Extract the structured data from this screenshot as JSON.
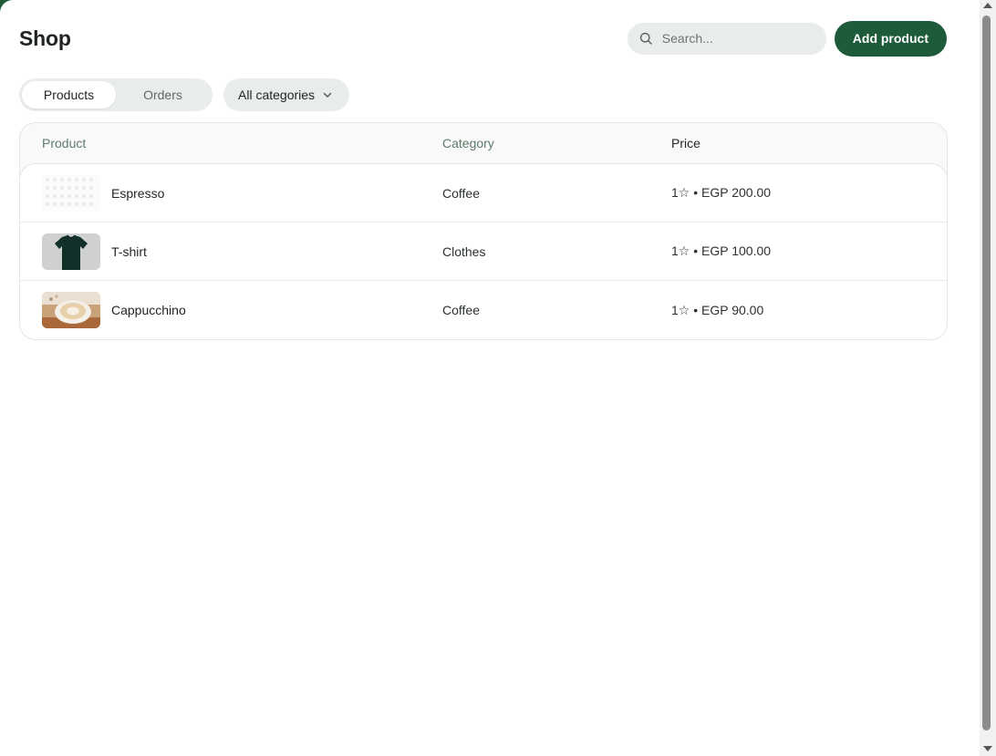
{
  "app": {
    "title": "Shop"
  },
  "search": {
    "placeholder": "Search..."
  },
  "actions": {
    "add_product": "Add product"
  },
  "tabs": [
    {
      "label": "Products",
      "active": true
    },
    {
      "label": "Orders",
      "active": false
    }
  ],
  "filter": {
    "selected": "All categories"
  },
  "table": {
    "headers": {
      "product": "Product",
      "category": "Category",
      "price": "Price"
    },
    "rows": [
      {
        "name": "Espresso",
        "category": "Coffee",
        "price": "1☆ • EGP 200.00",
        "thumb": "placeholder-grid"
      },
      {
        "name": "T-shirt",
        "category": "Clothes",
        "price": "1☆ • EGP 100.00",
        "thumb": "dark-tshirt"
      },
      {
        "name": "Cappucchino",
        "category": "Coffee",
        "price": "1☆ • EGP 90.00",
        "thumb": "cappuccino-cup"
      }
    ]
  },
  "colors": {
    "brand": "#1d5b3a",
    "muted_bg": "#e8ecea",
    "header_text": "#5f7a6b"
  },
  "icons": {
    "search": "search-icon",
    "dropdown": "chevron-down-icon"
  }
}
